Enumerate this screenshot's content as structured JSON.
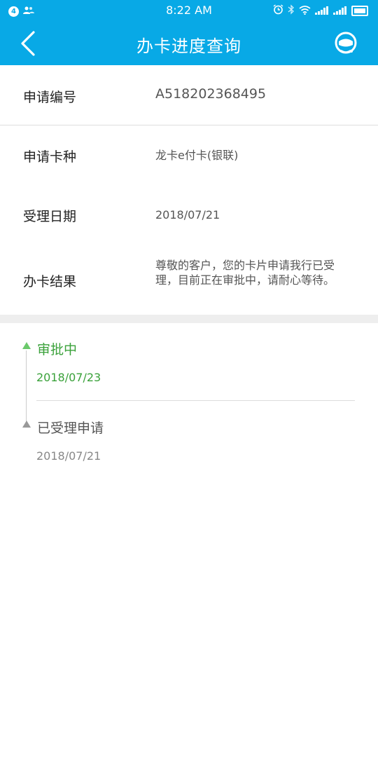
{
  "status_bar": {
    "notification_count": "4",
    "time": "8:22 AM"
  },
  "header": {
    "title": "办卡进度查询",
    "back_icon": "chevron-left-icon",
    "support_icon": "customer-service-icon"
  },
  "info": {
    "application_number": {
      "label": "申请编号",
      "value": "A518202368495"
    },
    "card_type": {
      "label": "申请卡种",
      "value": "龙卡e付卡(银联)"
    },
    "accept_date": {
      "label": "受理日期",
      "value": "2018/07/21"
    },
    "result": {
      "label": "办卡结果",
      "value": "尊敬的客户，您的卡片申请我行已受理，目前正在审批中，请耐心等待。"
    }
  },
  "timeline": [
    {
      "title": "审批中",
      "date": "2018/07/23",
      "status": "active",
      "color": "#3aa13a"
    },
    {
      "title": "已受理申请",
      "date": "2018/07/21",
      "status": "done",
      "color": "#999999"
    }
  ],
  "colors": {
    "brand": "#08a9e6",
    "active": "#6bc96b"
  }
}
